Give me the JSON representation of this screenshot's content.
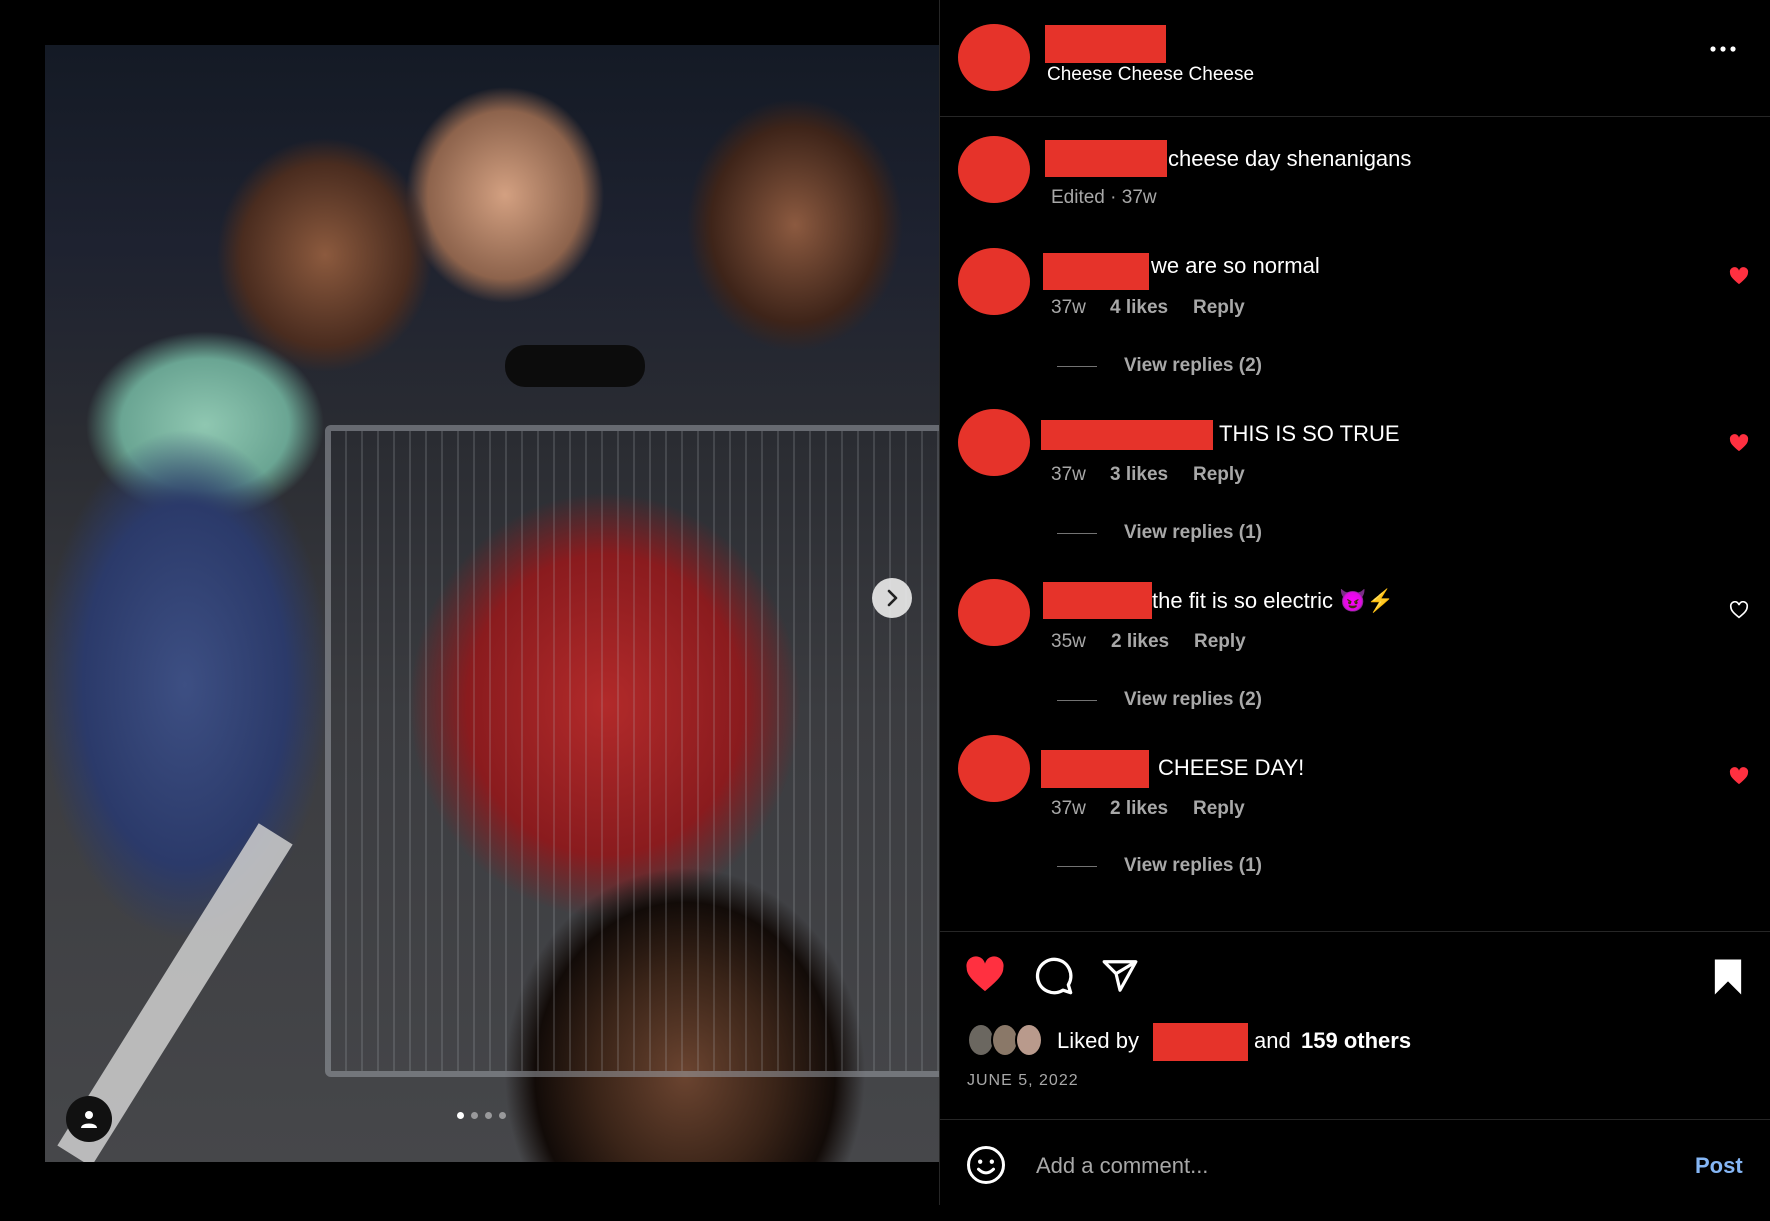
{
  "post": {
    "author_subtitle": "Cheese Cheese Cheese",
    "more_options": "...",
    "caption": {
      "text": "cheese day shenanigans",
      "meta": "Edited · 37w"
    },
    "carousel": {
      "total_slides": 4,
      "active_index": 0
    }
  },
  "comments": [
    {
      "text": "we are so normal",
      "age": "37w",
      "likes": "4 likes",
      "reply": "Reply",
      "view_replies": "View replies (2)",
      "liked": true
    },
    {
      "text": "THIS IS SO TRUE",
      "age": "37w",
      "likes": "3 likes",
      "reply": "Reply",
      "view_replies": "View replies (1)",
      "liked": true
    },
    {
      "text": "the fit is so electric 😈⚡",
      "age": "35w",
      "likes": "2 likes",
      "reply": "Reply",
      "view_replies": "View replies (2)",
      "liked": false
    },
    {
      "text": "CHEESE DAY!",
      "age": "37w",
      "likes": "2 likes",
      "reply": "Reply",
      "view_replies": "View replies (1)",
      "liked": true
    }
  ],
  "actions": {
    "liked_by_prefix": "Liked by",
    "liked_by_suffix": "and",
    "others": "159 others",
    "date": "JUNE 5, 2022"
  },
  "composer": {
    "placeholder": "Add a comment...",
    "post_label": "Post"
  },
  "colors": {
    "redaction": "#e6332a",
    "like_red": "#ff3040",
    "link_blue": "#85b6f5"
  }
}
